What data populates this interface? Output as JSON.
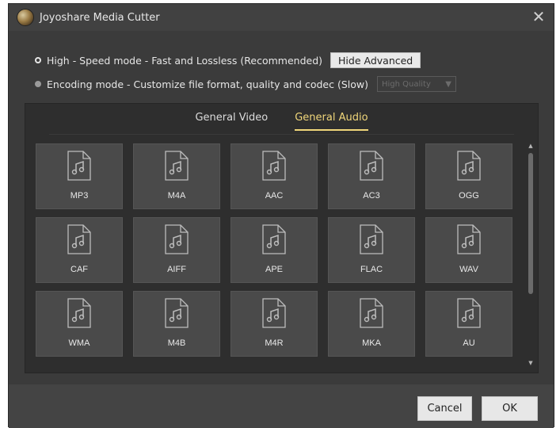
{
  "window": {
    "title": "Joyoshare Media Cutter",
    "close_glyph": "✕"
  },
  "options": {
    "high_speed_label": "High - Speed mode - Fast and Lossless (Recommended)",
    "hide_advanced_label": "Hide Advanced",
    "encoding_label": "Encoding mode - Customize file format, quality and codec (Slow)",
    "quality_value": "High Quality",
    "quality_arrow": "▼"
  },
  "tabs": [
    {
      "label": "General Video"
    },
    {
      "label": "General Audio"
    }
  ],
  "formats": [
    {
      "label": "MP3"
    },
    {
      "label": "M4A"
    },
    {
      "label": "AAC"
    },
    {
      "label": "AC3"
    },
    {
      "label": "OGG"
    },
    {
      "label": "CAF"
    },
    {
      "label": "AIFF"
    },
    {
      "label": "APE"
    },
    {
      "label": "FLAC"
    },
    {
      "label": "WAV"
    },
    {
      "label": "WMA"
    },
    {
      "label": "M4B"
    },
    {
      "label": "M4R"
    },
    {
      "label": "MKA"
    },
    {
      "label": "AU"
    }
  ],
  "scroll": {
    "up_glyph": "▲",
    "down_glyph": "▼"
  },
  "footer": {
    "cancel_label": "Cancel",
    "ok_label": "OK"
  },
  "colors": {
    "accent_tab": "#f0d67a",
    "background": "#3b3b3b",
    "tile": "#4a4a4a"
  }
}
